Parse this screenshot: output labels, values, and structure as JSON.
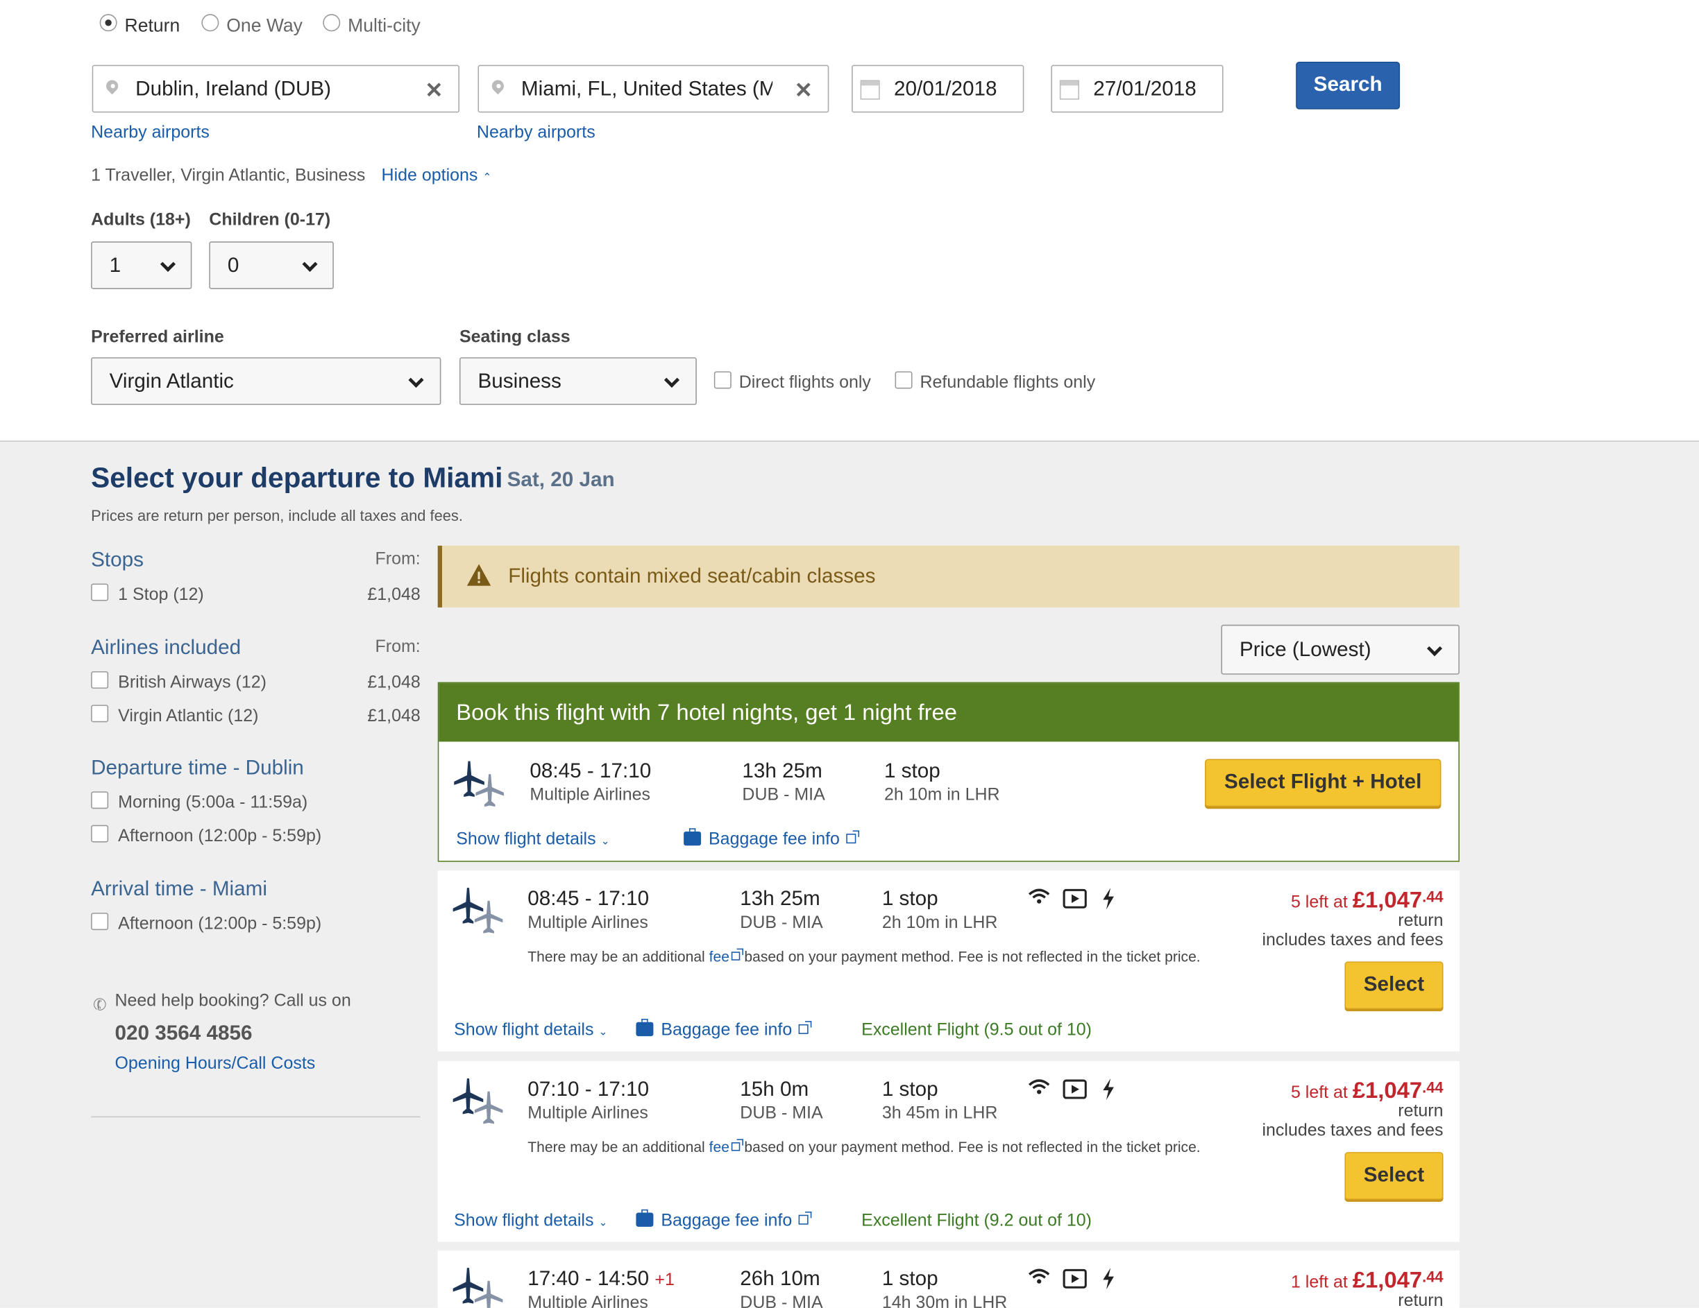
{
  "trip_type": {
    "options": [
      "Return",
      "One Way",
      "Multi-city"
    ],
    "selected": "Return"
  },
  "search": {
    "origin": "Dublin, Ireland (DUB)",
    "destination": "Miami, FL, United States (M",
    "depart_date": "20/01/2018",
    "return_date": "27/01/2018",
    "nearby_airports": "Nearby airports",
    "search_button": "Search",
    "summary": "1 Traveller, Virgin Atlantic, Business",
    "hide_options": "Hide options"
  },
  "options": {
    "adults_label": "Adults (18+)",
    "adults_value": "1",
    "children_label": "Children (0-17)",
    "children_value": "0",
    "airline_label": "Preferred airline",
    "airline_value": "Virgin Atlantic",
    "class_label": "Seating class",
    "class_value": "Business",
    "direct_only": "Direct flights only",
    "refundable_only": "Refundable flights only"
  },
  "results": {
    "title": "Select your departure to Miami",
    "date": "Sat, 20 Jan",
    "price_note": "Prices are return per person, include all taxes and fees.",
    "warning": "Flights contain mixed seat/cabin classes",
    "sort": "Price (Lowest)",
    "promo": "Book this flight with 7 hotel nights, get 1 night free"
  },
  "filters": {
    "from_label": "From:",
    "stops": {
      "title": "Stops",
      "items": [
        {
          "label": "1 Stop (12)",
          "price": "£1,048"
        }
      ]
    },
    "airlines": {
      "title": "Airlines included",
      "items": [
        {
          "label": "British Airways (12)",
          "price": "£1,048"
        },
        {
          "label": "Virgin Atlantic (12)",
          "price": "£1,048"
        }
      ]
    },
    "departure": {
      "title": "Departure time - Dublin",
      "items": [
        "Morning (5:00a - 11:59a)",
        "Afternoon (12:00p - 5:59p)"
      ]
    },
    "arrival": {
      "title": "Arrival time - Miami",
      "items": [
        "Afternoon (12:00p - 5:59p)"
      ]
    }
  },
  "help": {
    "text": "Need help booking? Call us on",
    "phone": "020 3564 4856",
    "link": "Opening Hours/Call Costs"
  },
  "flights": [
    {
      "times": "08:45 - 17:10",
      "airlines": "Multiple Airlines",
      "duration": "13h 25m",
      "route": "DUB - MIA",
      "stops": "1 stop",
      "layover": "2h 10m in LHR",
      "button": "Select Flight + Hotel",
      "details": "Show flight details",
      "baggage": "Baggage fee info"
    },
    {
      "times": "08:45 - 17:10",
      "airlines": "Multiple Airlines",
      "duration": "13h 25m",
      "route": "DUB - MIA",
      "stops": "1 stop",
      "layover": "2h 10m in LHR",
      "left": "5 left at",
      "price": "£1,047",
      "price_dec": ".44",
      "return": "return",
      "taxes": "includes taxes and fees",
      "note_a": "There may be an additional",
      "note_fee": "fee",
      "note_b": "based on your payment method. Fee is not reflected in the ticket price.",
      "button": "Select",
      "details": "Show flight details",
      "baggage": "Baggage fee info",
      "rating": "Excellent Flight (9.5 out of 10)"
    },
    {
      "times": "07:10 - 17:10",
      "airlines": "Multiple Airlines",
      "duration": "15h 0m",
      "route": "DUB - MIA",
      "stops": "1 stop",
      "layover": "3h 45m in LHR",
      "left": "5 left at",
      "price": "£1,047",
      "price_dec": ".44",
      "return": "return",
      "taxes": "includes taxes and fees",
      "note_a": "There may be an additional",
      "note_fee": "fee",
      "note_b": "based on your payment method. Fee is not reflected in the ticket price.",
      "button": "Select",
      "details": "Show flight details",
      "baggage": "Baggage fee info",
      "rating": "Excellent Flight (9.2 out of 10)"
    },
    {
      "times": "17:40 - 14:50",
      "plus_day": "+1",
      "airlines": "Multiple Airlines",
      "duration": "26h 10m",
      "route": "DUB - MIA",
      "stops": "1 stop",
      "layover": "14h 30m in LHR",
      "left": "1 left at",
      "price": "£1,047",
      "price_dec": ".44",
      "return": "return"
    }
  ],
  "icons": [
    "map-pin-icon",
    "clear-icon",
    "calendar-icon",
    "chevron-down-icon",
    "warning-icon",
    "plane-icon",
    "wifi-icon",
    "video-icon",
    "power-icon",
    "baggage-icon",
    "external-link-icon",
    "phone-icon"
  ],
  "colors": {
    "accent_blue": "#2a62ad",
    "link": "#1a5ca8",
    "promo_green": "#567e22",
    "select_yellow": "#f4c430",
    "price_red": "#c0262b",
    "warning_bg": "#ecdcb6",
    "heading_navy": "#1d3c67"
  }
}
